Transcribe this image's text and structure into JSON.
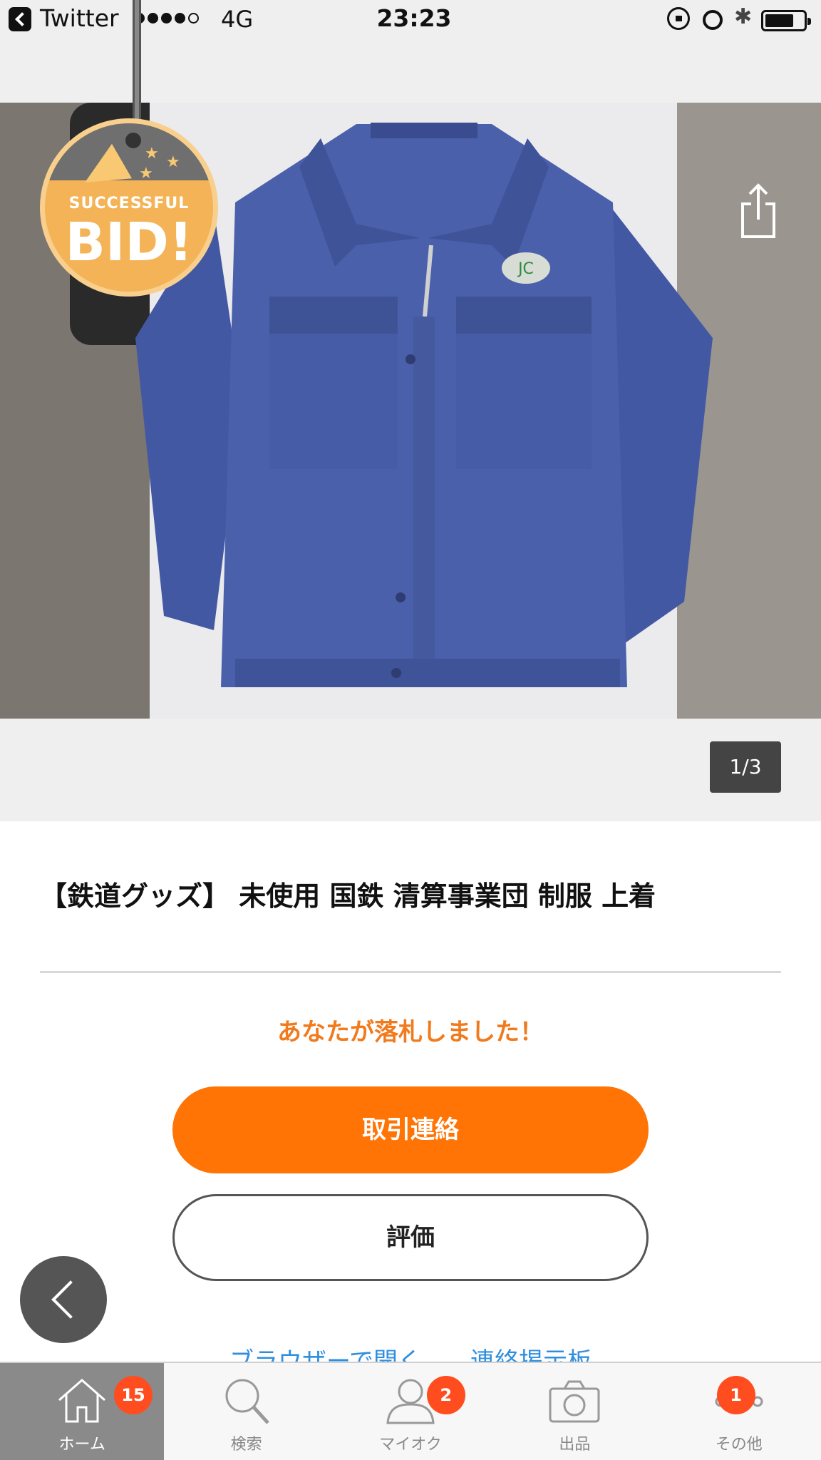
{
  "status_bar": {
    "back_app": "Twitter",
    "network": "4G",
    "time": "23:23",
    "battery_level": 0.75
  },
  "photo": {
    "badge_small": "SUCCESSFUL",
    "badge_big": "BID!",
    "counter": "1/3"
  },
  "item": {
    "title": "【鉄道グッズ】 未使用 国鉄 清算事業団 制服 上着"
  },
  "auction": {
    "won_message": "あなたが落札しました！",
    "contact_button": "取引連絡",
    "rate_button": "評価",
    "partial_link": "ブラウザーで開く　　連絡掲示板"
  },
  "tabbar": {
    "tabs": [
      {
        "label": "ホーム",
        "badge": "15",
        "icon": "home-icon",
        "active": true
      },
      {
        "label": "検索",
        "badge": "",
        "icon": "search-icon",
        "active": false
      },
      {
        "label": "マイオク",
        "badge": "2",
        "icon": "person-icon",
        "active": false
      },
      {
        "label": "出品",
        "badge": "",
        "icon": "camera-icon",
        "active": false
      },
      {
        "label": "その他",
        "badge": "1",
        "icon": "more-icon",
        "active": false
      }
    ]
  },
  "colors": {
    "accent": "#ff7404",
    "won_text": "#f07a1c",
    "badge": "#ff4d1f",
    "link": "#2f8fdf"
  }
}
